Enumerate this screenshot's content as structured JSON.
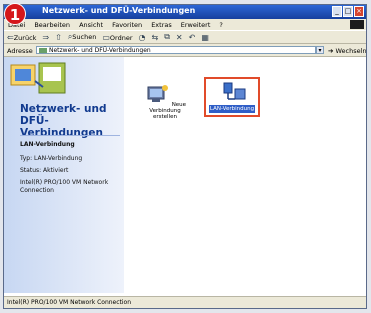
{
  "badge": {
    "number": "1"
  },
  "window": {
    "title": "Netzwerk- und DFÜ-Verbindungen"
  },
  "menu": [
    "Datei",
    "Bearbeiten",
    "Ansicht",
    "Favoriten",
    "Extras",
    "Erweitert",
    "?"
  ],
  "toolbar": {
    "back": "Zurück",
    "search": "Suchen",
    "folders": "Ordner"
  },
  "address": {
    "label": "Adresse",
    "value": "Netzwerk- und DFÜ-Verbindungen",
    "go": "Wechseln zu"
  },
  "sidepanel": {
    "title": "Netzwerk- und DFÜ-Verbindungen",
    "section_title": "LAN-Verbindung",
    "type": "Typ: LAN-Verbindung",
    "status": "Status: Aktiviert",
    "device": "Intel(R) PRO/100 VM Network Connection"
  },
  "items": [
    {
      "label": "Neue Verbindung erstellen"
    },
    {
      "label": "LAN-Verbindung"
    }
  ],
  "statusbar": {
    "text": "Intel(R) PRO/100 VM Network Connection"
  },
  "colors": {
    "highlight": "#e14b2a",
    "badge": "#d5171a",
    "selection": "#2f5ec7"
  }
}
